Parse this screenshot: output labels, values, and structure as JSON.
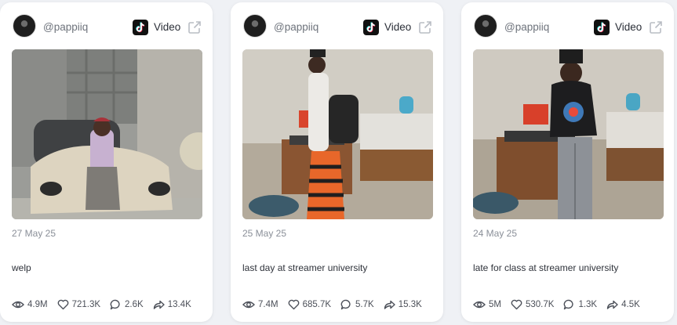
{
  "posts": [
    {
      "handle": "@pappiiq",
      "type_label": "Video",
      "date": "27 May 25",
      "caption": "welp",
      "views": "4.9M",
      "likes": "721.3K",
      "comments": "2.6K",
      "shares": "13.4K"
    },
    {
      "handle": "@pappiiq",
      "type_label": "Video",
      "date": "25 May 25",
      "caption": "last day at streamer university",
      "views": "7.4M",
      "likes": "685.7K",
      "comments": "5.7K",
      "shares": "15.3K"
    },
    {
      "handle": "@pappiiq",
      "type_label": "Video",
      "date": "24 May 25",
      "caption": "late for class at streamer university",
      "views": "5M",
      "likes": "530.7K",
      "comments": "1.3K",
      "shares": "4.5K"
    }
  ],
  "icons": {
    "platform": "tiktok-icon",
    "external": "external-link-icon",
    "views": "eye-icon",
    "likes": "heart-icon",
    "comments": "comment-icon",
    "shares": "share-icon"
  },
  "colors": {
    "card_bg": "#ffffff",
    "page_bg": "#eff1f5",
    "muted_text": "#8a8f98"
  }
}
